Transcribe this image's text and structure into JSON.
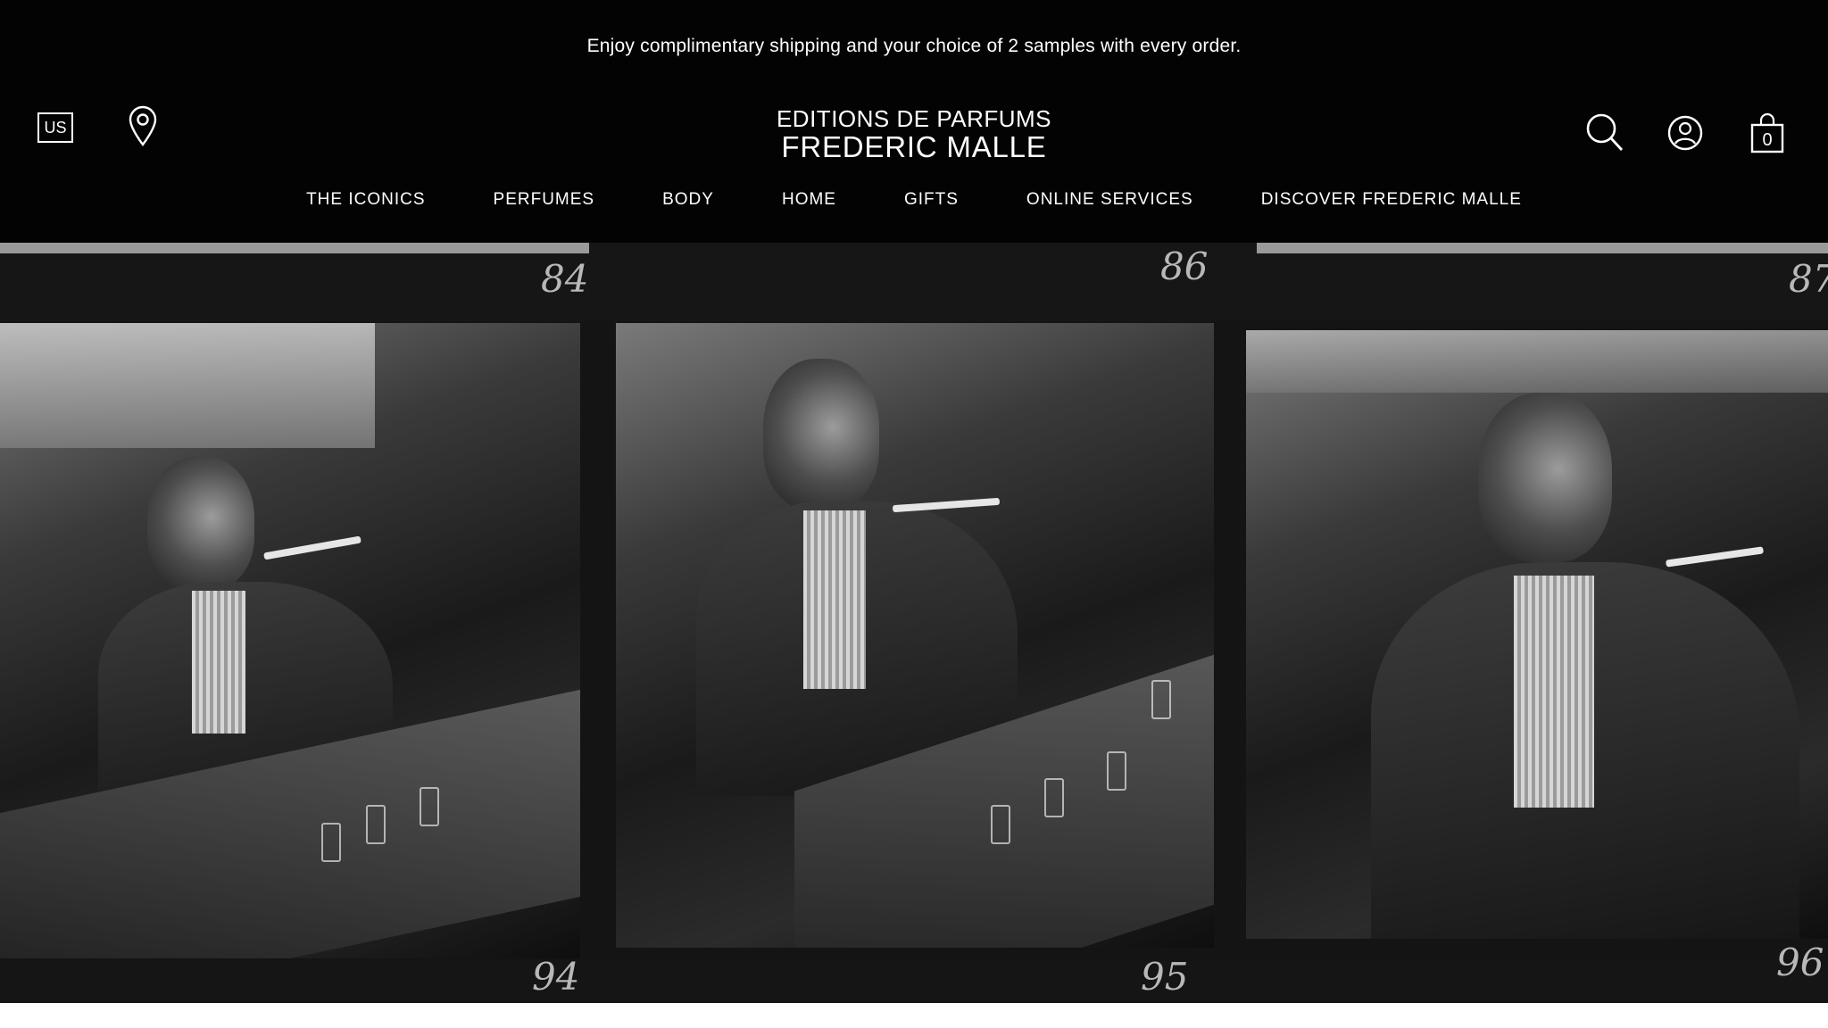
{
  "promo": {
    "text": "Enjoy complimentary shipping and your choice of 2 samples with every order."
  },
  "header": {
    "locale": "US",
    "logo_line1": "EDITIONS DE PARFUMS",
    "logo_line2": "FREDERIC MALLE",
    "cart_count": "0",
    "icons": [
      "store-locator-icon",
      "search-icon",
      "account-icon",
      "bag-icon"
    ]
  },
  "nav": {
    "items": [
      {
        "label": "THE ICONICS"
      },
      {
        "label": "PERFUMES"
      },
      {
        "label": "BODY"
      },
      {
        "label": "HOME"
      },
      {
        "label": "GIFTS"
      },
      {
        "label": "ONLINE SERVICES"
      },
      {
        "label": "DISCOVER FREDERIC MALLE"
      }
    ]
  },
  "hero": {
    "frame_numbers_top": [
      "84",
      "86",
      "87"
    ],
    "frame_numbers_bottom": [
      "94",
      "95",
      "96"
    ]
  },
  "colors": {
    "background": "#030303",
    "text": "#ffffff"
  }
}
